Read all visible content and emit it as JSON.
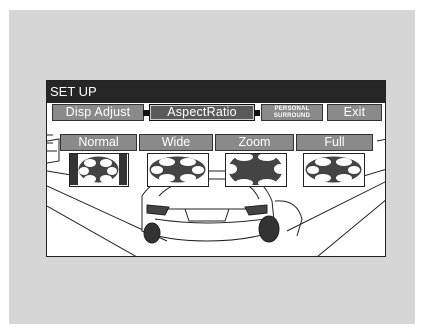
{
  "window": {
    "title": "SET UP"
  },
  "top_menu": {
    "items": [
      {
        "label": "Disp Adjust",
        "active": false
      },
      {
        "label": "AspectRatio",
        "active": true
      },
      {
        "label_line1": "PERSONAL",
        "label_line2": "SURROUND",
        "active": false
      },
      {
        "label": "Exit",
        "active": false
      }
    ]
  },
  "aspect_options": {
    "items": [
      {
        "label": "Normal"
      },
      {
        "label": "Wide"
      },
      {
        "label": "Zoom"
      },
      {
        "label": "Full"
      }
    ]
  },
  "colors": {
    "title_bar": "#262626",
    "button_fill": "#8a8a8a",
    "button_text": "#ffffff",
    "panel_bg": "#d6d6d6"
  }
}
